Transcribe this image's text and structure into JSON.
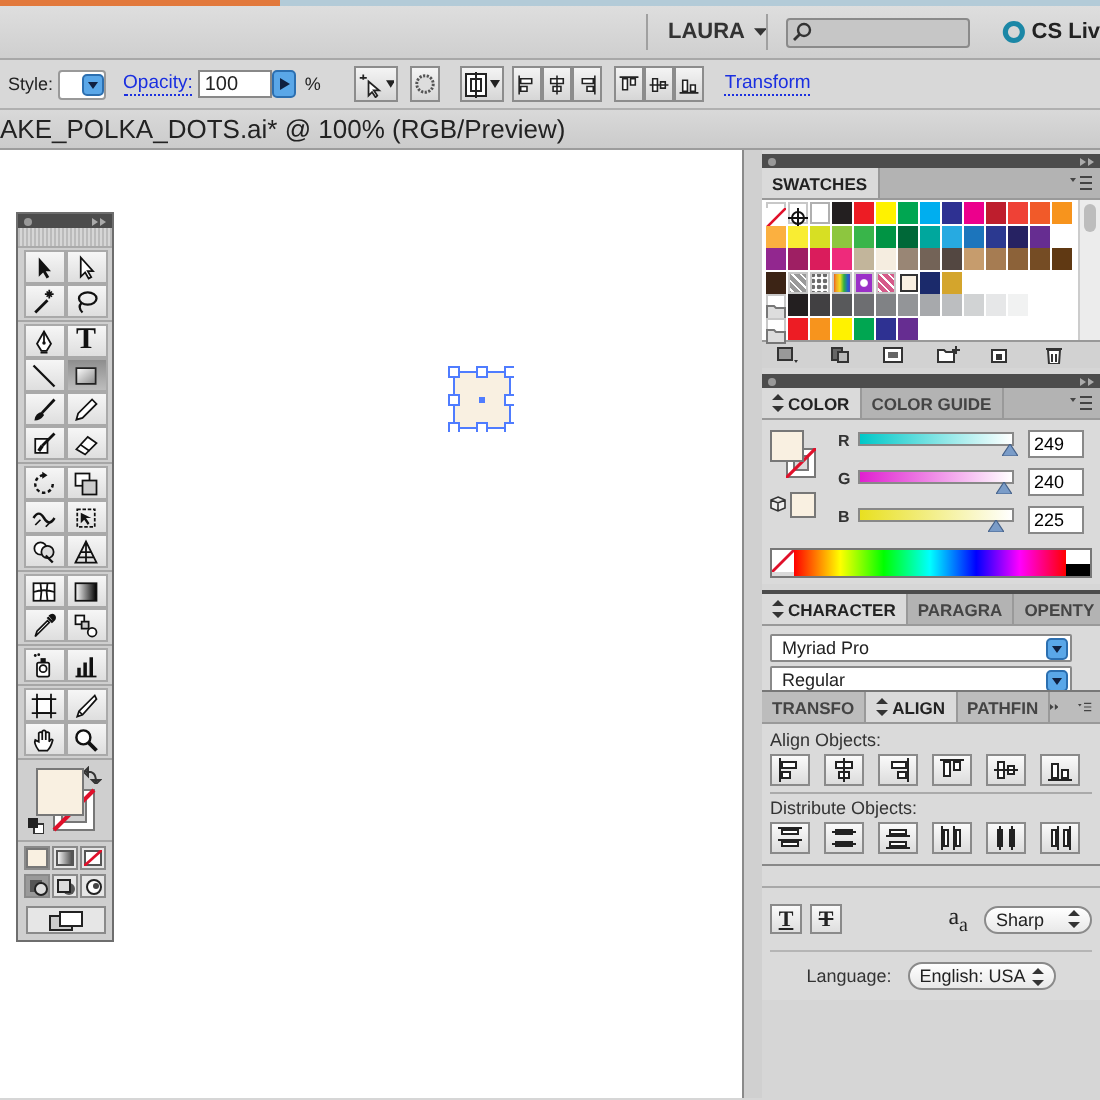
{
  "top_bar": {
    "user": "LAURA",
    "cs_live": "CS Liv"
  },
  "control_bar": {
    "style_label": "Style:",
    "opacity_label": "Opacity:",
    "opacity": "100",
    "percent": "%",
    "transform_link": "Transform"
  },
  "document_tab": {
    "title": "AKE_POLKA_DOTS.ai* @ 100% (RGB/Preview)"
  },
  "tools": {
    "groups": [
      [
        {
          "kind": "selection",
          "selected": false
        },
        {
          "kind": "direct-selection",
          "selected": false
        },
        {
          "kind": "magic-wand",
          "selected": false
        },
        {
          "kind": "lasso",
          "selected": false
        }
      ],
      [
        {
          "kind": "pen",
          "selected": false
        },
        {
          "kind": "type",
          "selected": false,
          "glyph": "T"
        },
        {
          "kind": "line",
          "selected": false
        },
        {
          "kind": "rectangle",
          "selected": true
        },
        {
          "kind": "paintbrush",
          "selected": false
        },
        {
          "kind": "pencil",
          "selected": false
        },
        {
          "kind": "blob-brush",
          "selected": false
        },
        {
          "kind": "eraser",
          "selected": false
        }
      ],
      [
        {
          "kind": "rotate",
          "selected": false
        },
        {
          "kind": "scale",
          "selected": false
        },
        {
          "kind": "warp",
          "selected": false
        },
        {
          "kind": "free-transform",
          "selected": false
        },
        {
          "kind": "shape-builder",
          "selected": false
        },
        {
          "kind": "perspective-grid",
          "selected": false
        }
      ],
      [
        {
          "kind": "mesh",
          "selected": false
        },
        {
          "kind": "gradient",
          "selected": false
        },
        {
          "kind": "eyedropper",
          "selected": false
        },
        {
          "kind": "blend",
          "selected": false
        }
      ],
      [
        {
          "kind": "symbol-sprayer",
          "selected": false
        },
        {
          "kind": "graph",
          "selected": false
        }
      ],
      [
        {
          "kind": "artboard",
          "selected": false
        },
        {
          "kind": "slice",
          "selected": false
        },
        {
          "kind": "hand",
          "selected": false
        },
        {
          "kind": "zoom",
          "selected": false
        }
      ]
    ]
  },
  "swatches": {
    "tab": "SWATCHES",
    "rows": [
      [
        {
          "kind": "none",
          "selected": false
        },
        {
          "kind": "registration",
          "selected": false
        },
        {
          "kind": "solid",
          "color": "#ffffff",
          "selected": false
        },
        {
          "kind": "solid",
          "color": "#231f20",
          "selected": false
        },
        {
          "kind": "solid",
          "color": "#ed1c24",
          "selected": false
        },
        {
          "kind": "solid",
          "color": "#fff200",
          "selected": false
        },
        {
          "kind": "solid",
          "color": "#00a651",
          "selected": false
        },
        {
          "kind": "solid",
          "color": "#00aeef",
          "selected": false
        },
        {
          "kind": "solid",
          "color": "#2e3192",
          "selected": false
        },
        {
          "kind": "solid",
          "color": "#ec008c",
          "selected": false
        },
        {
          "kind": "solid",
          "color": "#be1e2d",
          "selected": false
        },
        {
          "kind": "solid",
          "color": "#ef4136",
          "selected": false
        },
        {
          "kind": "solid",
          "color": "#f15a29",
          "selected": false
        },
        {
          "kind": "solid",
          "color": "#f7941d",
          "selected": false
        }
      ],
      [
        {
          "kind": "solid",
          "color": "#fbb040",
          "selected": false
        },
        {
          "kind": "solid",
          "color": "#f9ed32",
          "selected": false
        },
        {
          "kind": "solid",
          "color": "#d7df23",
          "selected": false
        },
        {
          "kind": "solid",
          "color": "#8dc63f",
          "selected": false
        },
        {
          "kind": "solid",
          "color": "#39b54a",
          "selected": false
        },
        {
          "kind": "solid",
          "color": "#009444",
          "selected": false
        },
        {
          "kind": "solid",
          "color": "#006838",
          "selected": false
        },
        {
          "kind": "solid",
          "color": "#00a79d",
          "selected": false
        },
        {
          "kind": "solid",
          "color": "#27aae1",
          "selected": false
        },
        {
          "kind": "solid",
          "color": "#1c75bc",
          "selected": false
        },
        {
          "kind": "solid",
          "color": "#2b3990",
          "selected": false
        },
        {
          "kind": "solid",
          "color": "#262262",
          "selected": false
        },
        {
          "kind": "solid",
          "color": "#662d91",
          "selected": false
        }
      ],
      [
        {
          "kind": "solid",
          "color": "#92278f",
          "selected": false
        },
        {
          "kind": "solid",
          "color": "#9e1f63",
          "selected": false
        },
        {
          "kind": "solid",
          "color": "#da1c5c",
          "selected": false
        },
        {
          "kind": "solid",
          "color": "#ee2a7b",
          "selected": false
        },
        {
          "kind": "solid",
          "color": "#c2b59b",
          "selected": false
        },
        {
          "kind": "solid",
          "color": "#f5ede0",
          "selected": false
        },
        {
          "kind": "solid",
          "color": "#998675",
          "selected": false
        },
        {
          "kind": "solid",
          "color": "#736357",
          "selected": false
        },
        {
          "kind": "solid",
          "color": "#534741",
          "selected": false
        },
        {
          "kind": "solid",
          "color": "#c69c6d",
          "selected": false
        },
        {
          "kind": "solid",
          "color": "#a67c52",
          "selected": false
        },
        {
          "kind": "solid",
          "color": "#8c6239",
          "selected": false
        },
        {
          "kind": "solid",
          "color": "#754c24",
          "selected": false
        },
        {
          "kind": "solid",
          "color": "#603913",
          "selected": false
        }
      ],
      [
        {
          "kind": "solid",
          "color": "#3c2415",
          "selected": false
        },
        {
          "kind": "pattern",
          "color": "#9a9a9a",
          "selected": false
        },
        {
          "kind": "dots",
          "color": "#6a6a6a",
          "selected": false
        },
        {
          "kind": "gradient",
          "selected": false
        },
        {
          "kind": "radial",
          "color": "#9b30c8",
          "selected": false
        },
        {
          "kind": "pattern",
          "color": "#d55a8a",
          "selected": false
        },
        {
          "kind": "solid",
          "color": "#f9f0e1",
          "selected": true
        },
        {
          "kind": "solid",
          "color": "#1b2a6b",
          "selected": false
        },
        {
          "kind": "solid",
          "color": "#d4a52c",
          "selected": false
        }
      ],
      [
        {
          "kind": "folder",
          "selected": false
        },
        {
          "kind": "solid",
          "color": "#231f20",
          "selected": false
        },
        {
          "kind": "solid",
          "color": "#414042",
          "selected": false
        },
        {
          "kind": "solid",
          "color": "#58595b",
          "selected": false
        },
        {
          "kind": "solid",
          "color": "#6d6e71",
          "selected": false
        },
        {
          "kind": "solid",
          "color": "#808285",
          "selected": false
        },
        {
          "kind": "solid",
          "color": "#939598",
          "selected": false
        },
        {
          "kind": "solid",
          "color": "#a7a9ac",
          "selected": false
        },
        {
          "kind": "solid",
          "color": "#bcbec0",
          "selected": false
        },
        {
          "kind": "solid",
          "color": "#d1d3d4",
          "selected": false
        },
        {
          "kind": "solid",
          "color": "#e6e7e8",
          "selected": false
        },
        {
          "kind": "solid",
          "color": "#f1f2f2",
          "selected": false
        }
      ],
      [
        {
          "kind": "folder",
          "selected": false
        },
        {
          "kind": "solid",
          "color": "#ed1c24",
          "selected": false
        },
        {
          "kind": "solid",
          "color": "#f7941d",
          "selected": false
        },
        {
          "kind": "solid",
          "color": "#fff200",
          "selected": false
        },
        {
          "kind": "solid",
          "color": "#00a651",
          "selected": false
        },
        {
          "kind": "solid",
          "color": "#2e3192",
          "selected": false
        },
        {
          "kind": "solid",
          "color": "#662d91",
          "selected": false
        }
      ]
    ]
  },
  "color": {
    "tabs": [
      {
        "label": "COLOR",
        "selected": true
      },
      {
        "label": "COLOR GUIDE",
        "selected": false
      }
    ],
    "channels": [
      {
        "name": "R",
        "level": 0.976,
        "value": "249"
      },
      {
        "name": "G",
        "level": 0.941,
        "value": "240"
      },
      {
        "name": "B",
        "level": 0.882,
        "value": "225"
      }
    ]
  },
  "character": {
    "tabs": [
      {
        "label": "CHARACTER",
        "selected": true
      },
      {
        "label": "PARAGRA",
        "selected": false
      },
      {
        "label": "OPENTY",
        "selected": false
      }
    ],
    "font": "Myriad Pro",
    "style": "Regular",
    "underline_button": "T",
    "strikethrough_button": "T",
    "antialias_label": "a$_{a}$",
    "antialias": "Sharp",
    "language_label": "Language:",
    "language": "English: USA"
  },
  "align": {
    "tabs": [
      {
        "label": "TRANSFO",
        "selected": false
      },
      {
        "label": "ALIGN",
        "selected": true
      },
      {
        "label": "PATHFIN",
        "selected": false
      }
    ],
    "align_label": "Align Objects:",
    "distribute_label": "Distribute Objects:"
  }
}
